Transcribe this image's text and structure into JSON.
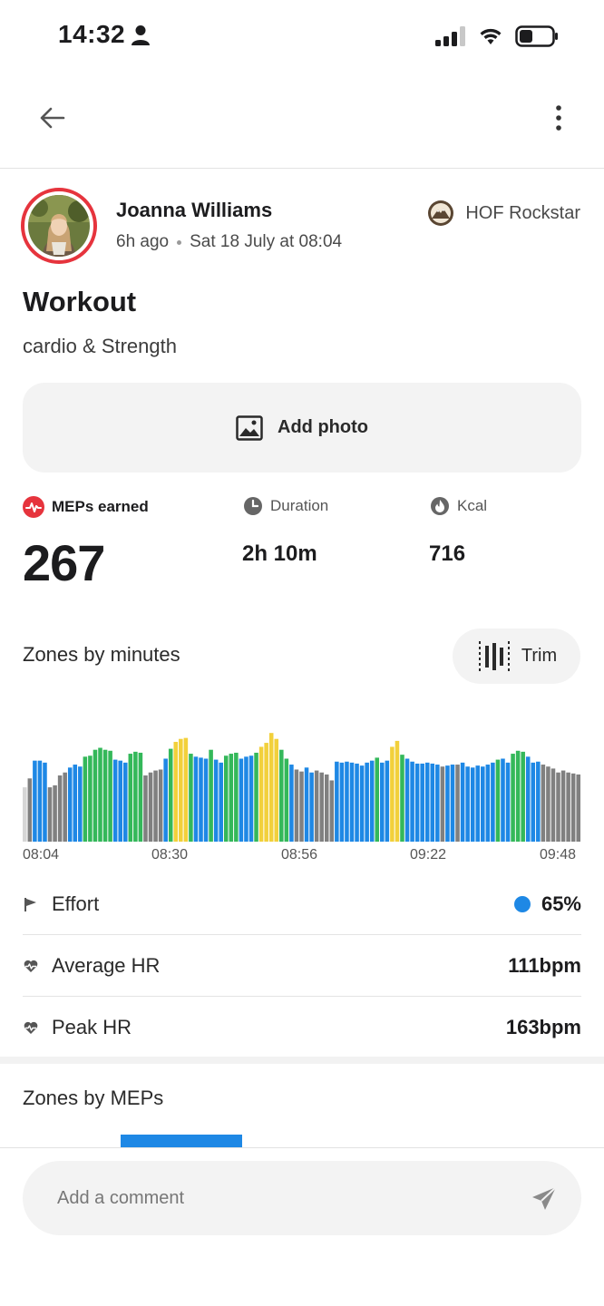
{
  "status_bar": {
    "time": "14:32",
    "icons": [
      "person-icon",
      "signal-icon",
      "wifi-icon",
      "battery-icon"
    ]
  },
  "header": {
    "back_icon": "arrow-left-icon",
    "more_icon": "more-vertical-icon"
  },
  "post": {
    "user_name": "Joanna Williams",
    "time_ago": "6h ago",
    "date": "Sat 18 July at 08:04",
    "badge": "HOF Rockstar",
    "title": "Workout",
    "subtitle": "cardio & Strength",
    "add_photo_label": "Add photo"
  },
  "stats": {
    "meps_label": "MEPs earned",
    "meps_value": "267",
    "duration_label": "Duration",
    "duration_value": "2h 10m",
    "kcal_label": "Kcal",
    "kcal_value": "716"
  },
  "zones": {
    "title": "Zones by minutes",
    "trim_label": "Trim"
  },
  "chart_data": {
    "type": "bar",
    "xlabel": "",
    "ylabel": "",
    "x_tick_labels": [
      "08:04",
      "08:30",
      "08:56",
      "09:22",
      "09:48"
    ],
    "zone_colors": {
      "grey": "#808080",
      "blue": "#1e88e5",
      "green": "#34b85a",
      "yellow": "#f2d03b",
      "light": "#d6d6d6"
    },
    "bars": [
      {
        "zone": "light",
        "value": 55
      },
      {
        "zone": "grey",
        "value": 64
      },
      {
        "zone": "blue",
        "value": 82
      },
      {
        "zone": "blue",
        "value": 82
      },
      {
        "zone": "blue",
        "value": 80
      },
      {
        "zone": "grey",
        "value": 55
      },
      {
        "zone": "grey",
        "value": 57
      },
      {
        "zone": "grey",
        "value": 67
      },
      {
        "zone": "grey",
        "value": 70
      },
      {
        "zone": "blue",
        "value": 75
      },
      {
        "zone": "blue",
        "value": 78
      },
      {
        "zone": "blue",
        "value": 76
      },
      {
        "zone": "green",
        "value": 86
      },
      {
        "zone": "green",
        "value": 87
      },
      {
        "zone": "green",
        "value": 93
      },
      {
        "zone": "green",
        "value": 95
      },
      {
        "zone": "green",
        "value": 93
      },
      {
        "zone": "green",
        "value": 92
      },
      {
        "zone": "blue",
        "value": 83
      },
      {
        "zone": "blue",
        "value": 82
      },
      {
        "zone": "blue",
        "value": 80
      },
      {
        "zone": "green",
        "value": 89
      },
      {
        "zone": "green",
        "value": 91
      },
      {
        "zone": "green",
        "value": 90
      },
      {
        "zone": "grey",
        "value": 67
      },
      {
        "zone": "grey",
        "value": 70
      },
      {
        "zone": "grey",
        "value": 72
      },
      {
        "zone": "grey",
        "value": 73
      },
      {
        "zone": "blue",
        "value": 84
      },
      {
        "zone": "green",
        "value": 94
      },
      {
        "zone": "yellow",
        "value": 101
      },
      {
        "zone": "yellow",
        "value": 104
      },
      {
        "zone": "yellow",
        "value": 105
      },
      {
        "zone": "green",
        "value": 89
      },
      {
        "zone": "blue",
        "value": 86
      },
      {
        "zone": "blue",
        "value": 85
      },
      {
        "zone": "blue",
        "value": 84
      },
      {
        "zone": "green",
        "value": 93
      },
      {
        "zone": "blue",
        "value": 83
      },
      {
        "zone": "blue",
        "value": 80
      },
      {
        "zone": "green",
        "value": 87
      },
      {
        "zone": "green",
        "value": 89
      },
      {
        "zone": "green",
        "value": 90
      },
      {
        "zone": "blue",
        "value": 84
      },
      {
        "zone": "blue",
        "value": 86
      },
      {
        "zone": "blue",
        "value": 87
      },
      {
        "zone": "green",
        "value": 90
      },
      {
        "zone": "yellow",
        "value": 96
      },
      {
        "zone": "yellow",
        "value": 100
      },
      {
        "zone": "yellow",
        "value": 110
      },
      {
        "zone": "yellow",
        "value": 104
      },
      {
        "zone": "green",
        "value": 93
      },
      {
        "zone": "green",
        "value": 84
      },
      {
        "zone": "blue",
        "value": 78
      },
      {
        "zone": "grey",
        "value": 73
      },
      {
        "zone": "grey",
        "value": 71
      },
      {
        "zone": "blue",
        "value": 75
      },
      {
        "zone": "blue",
        "value": 70
      },
      {
        "zone": "grey",
        "value": 72
      },
      {
        "zone": "grey",
        "value": 70
      },
      {
        "zone": "grey",
        "value": 68
      },
      {
        "zone": "grey",
        "value": 62
      },
      {
        "zone": "blue",
        "value": 81
      },
      {
        "zone": "blue",
        "value": 80
      },
      {
        "zone": "blue",
        "value": 81
      },
      {
        "zone": "blue",
        "value": 80
      },
      {
        "zone": "blue",
        "value": 79
      },
      {
        "zone": "blue",
        "value": 77
      },
      {
        "zone": "blue",
        "value": 80
      },
      {
        "zone": "blue",
        "value": 82
      },
      {
        "zone": "green",
        "value": 85
      },
      {
        "zone": "blue",
        "value": 80
      },
      {
        "zone": "blue",
        "value": 82
      },
      {
        "zone": "yellow",
        "value": 96
      },
      {
        "zone": "yellow",
        "value": 102
      },
      {
        "zone": "green",
        "value": 88
      },
      {
        "zone": "blue",
        "value": 84
      },
      {
        "zone": "blue",
        "value": 81
      },
      {
        "zone": "blue",
        "value": 79
      },
      {
        "zone": "blue",
        "value": 79
      },
      {
        "zone": "blue",
        "value": 80
      },
      {
        "zone": "blue",
        "value": 79
      },
      {
        "zone": "blue",
        "value": 78
      },
      {
        "zone": "grey",
        "value": 76
      },
      {
        "zone": "blue",
        "value": 77
      },
      {
        "zone": "blue",
        "value": 78
      },
      {
        "zone": "grey",
        "value": 78
      },
      {
        "zone": "blue",
        "value": 80
      },
      {
        "zone": "blue",
        "value": 76
      },
      {
        "zone": "blue",
        "value": 75
      },
      {
        "zone": "blue",
        "value": 77
      },
      {
        "zone": "blue",
        "value": 76
      },
      {
        "zone": "blue",
        "value": 78
      },
      {
        "zone": "blue",
        "value": 80
      },
      {
        "zone": "green",
        "value": 83
      },
      {
        "zone": "blue",
        "value": 84
      },
      {
        "zone": "blue",
        "value": 80
      },
      {
        "zone": "green",
        "value": 89
      },
      {
        "zone": "green",
        "value": 92
      },
      {
        "zone": "green",
        "value": 91
      },
      {
        "zone": "blue",
        "value": 86
      },
      {
        "zone": "blue",
        "value": 80
      },
      {
        "zone": "blue",
        "value": 81
      },
      {
        "zone": "grey",
        "value": 78
      },
      {
        "zone": "grey",
        "value": 76
      },
      {
        "zone": "grey",
        "value": 74
      },
      {
        "zone": "grey",
        "value": 70
      },
      {
        "zone": "grey",
        "value": 72
      },
      {
        "zone": "grey",
        "value": 70
      },
      {
        "zone": "grey",
        "value": 69
      },
      {
        "zone": "grey",
        "value": 68
      }
    ]
  },
  "metrics": {
    "effort_label": "Effort",
    "effort_value": "65%",
    "avg_hr_label": "Average HR",
    "avg_hr_value": "111bpm",
    "peak_hr_label": "Peak HR",
    "peak_hr_value": "163bpm"
  },
  "meps_zones": {
    "title": "Zones by MEPs"
  },
  "comment": {
    "placeholder": "Add a comment",
    "send_icon": "send-icon"
  },
  "colors": {
    "accent_red": "#e6343d",
    "accent_blue": "#1e88e5"
  }
}
